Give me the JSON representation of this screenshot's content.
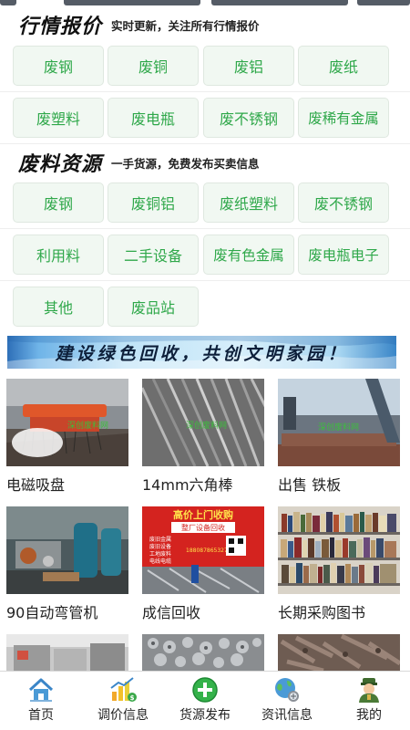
{
  "quotes": {
    "title": "行情报价",
    "subtitle": "实时更新，关注所有行情报价",
    "buttons": [
      "废钢",
      "废铜",
      "废铝",
      "废纸",
      "废塑料",
      "废电瓶",
      "废不锈钢",
      "废稀有金属"
    ]
  },
  "resources": {
    "title": "废料资源",
    "subtitle": "一手货源，免费发布买卖信息",
    "buttons": [
      "废钢",
      "废铜铝",
      "废纸塑料",
      "废不锈钢",
      "利用料",
      "二手设备",
      "废有色金属",
      "废电瓶电子",
      "其他",
      "废品站"
    ]
  },
  "banner": {
    "text": "建设绿色回收，共创文明家园！"
  },
  "listings": {
    "items": [
      {
        "title": "电磁吸盘",
        "watermark": "深创废料网"
      },
      {
        "title": "14mm六角棒",
        "watermark": "深创废料网"
      },
      {
        "title": "出售 铁板",
        "watermark": "深创废料网"
      },
      {
        "title": "90自动弯管机",
        "watermark": ""
      },
      {
        "title": "成信回收",
        "watermark": ""
      },
      {
        "title": "长期采购图书",
        "watermark": ""
      },
      {
        "title": "",
        "watermark": ""
      },
      {
        "title": "",
        "watermark": ""
      },
      {
        "title": "",
        "watermark": ""
      }
    ],
    "poster": {
      "headline": "高价上门收购",
      "subline": "整厂设备回收",
      "lines": [
        "废旧金属",
        "废旧设备",
        "工地废料",
        "电线电缆"
      ],
      "phone": "188087865327"
    }
  },
  "tabbar": {
    "items": [
      {
        "label": "首页",
        "icon": "home-icon"
      },
      {
        "label": "调价信息",
        "icon": "price-chart-icon"
      },
      {
        "label": "货源发布",
        "icon": "plus-circle-icon"
      },
      {
        "label": "资讯信息",
        "icon": "globe-icon"
      },
      {
        "label": "我的",
        "icon": "user-avatar-icon"
      }
    ]
  },
  "colors": {
    "accent_green": "#2fa84a",
    "button_bg": "#f1f8f2"
  }
}
